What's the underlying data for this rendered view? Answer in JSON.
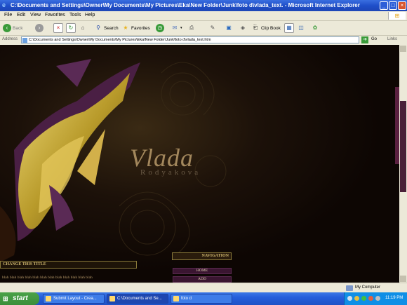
{
  "window": {
    "title": "C:\\Documents and Settings\\Owner\\My Documents\\My Pictures\\Eka\\New Folder\\Junk\\foto d\\vlada_text. - Microsoft Internet Explorer"
  },
  "menu": {
    "items": [
      "File",
      "Edit",
      "View",
      "Favorites",
      "Tools",
      "Help"
    ]
  },
  "toolbar": {
    "back_label": "Back",
    "search_label": "Search",
    "favorites_label": "Favorites",
    "clipbook_label": "Clip Book"
  },
  "address": {
    "label": "Address",
    "url": "C:\\Documents and Settings\\Owner\\My Documents\\My Pictures\\Eka\\New Folder\\Junk\\foto d\\vlada_text.htm",
    "go_label": "Go",
    "links_label": "Links"
  },
  "page": {
    "logo_name": "Vlada",
    "logo_surname": "Rodyakova",
    "nav_heading": "NAVIGATION",
    "nav_items": [
      "HOME",
      "ADD"
    ],
    "title_box": "CHANGE THIS TITLE",
    "body_text": "blah blah blah blah blah blah blah blah blah blah blah blah"
  },
  "statusbar": {
    "zone": "My Computer"
  },
  "taskbar": {
    "start_label": "start",
    "tasks": [
      "Submit Layout - Crea...",
      "C:\\Documents and Se...",
      "foto d"
    ],
    "clock": "11:19 PM"
  },
  "colors": {
    "accent_gold": "#c8a84a",
    "accent_purple": "#5a2a55",
    "background": "#0d0603"
  }
}
